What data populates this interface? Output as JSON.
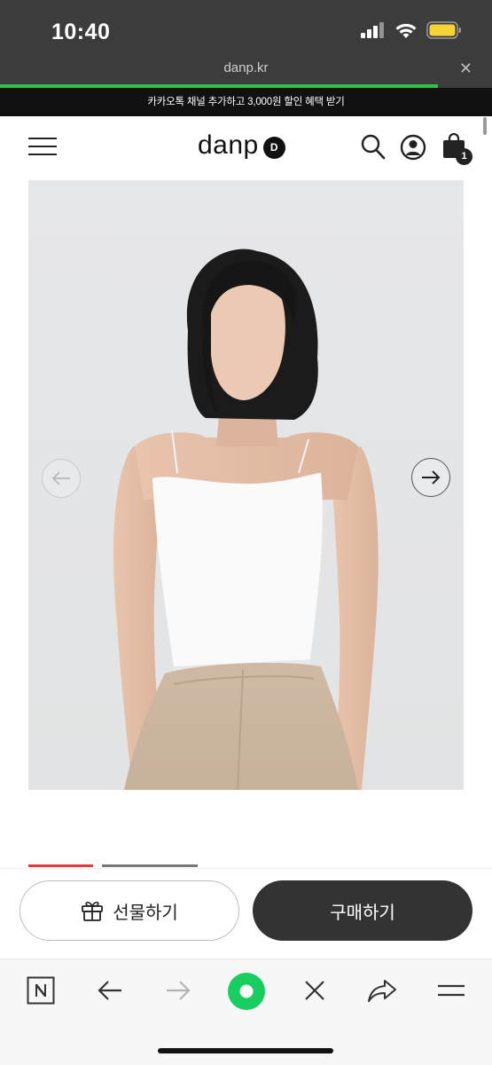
{
  "status_bar": {
    "time": "10:40"
  },
  "browser": {
    "url": "danp.kr",
    "close_icon": "close-icon",
    "progress_fraction": 0.89
  },
  "promo": {
    "text": "카카오톡 채널 추가하고 3,000원 할인 혜택 받기"
  },
  "header": {
    "logo_text": "danp",
    "logo_mark": "D",
    "menu_icon": "hamburger-menu-icon",
    "search_icon": "search-icon",
    "account_icon": "user-account-icon",
    "cart_icon": "shopping-bag-icon",
    "cart_count": "1"
  },
  "product": {
    "image_subject": "woman-in-white-camisole",
    "prev_icon": "arrow-left-icon",
    "next_icon": "arrow-right-icon",
    "slide_indicator": {
      "active_index": 0,
      "visible_count": 2
    }
  },
  "actions": {
    "gift_label": "선물하기",
    "gift_icon": "gift-icon",
    "buy_label": "구매하기"
  },
  "toolbar": {
    "items": [
      "naver-n-icon",
      "back-arrow-icon",
      "forward-arrow-icon",
      "green-home-dot-icon",
      "close-x-icon",
      "share-icon",
      "menu-lines-icon"
    ]
  },
  "colors": {
    "status_bar_bg": "#3c3c3c",
    "progress_green": "#2fc34a",
    "promo_bg": "#111111",
    "indicator_active": "#e23b3b",
    "buy_button_bg": "#333333",
    "naver_green": "#19ce60",
    "battery_yellow": "#f5d433"
  }
}
